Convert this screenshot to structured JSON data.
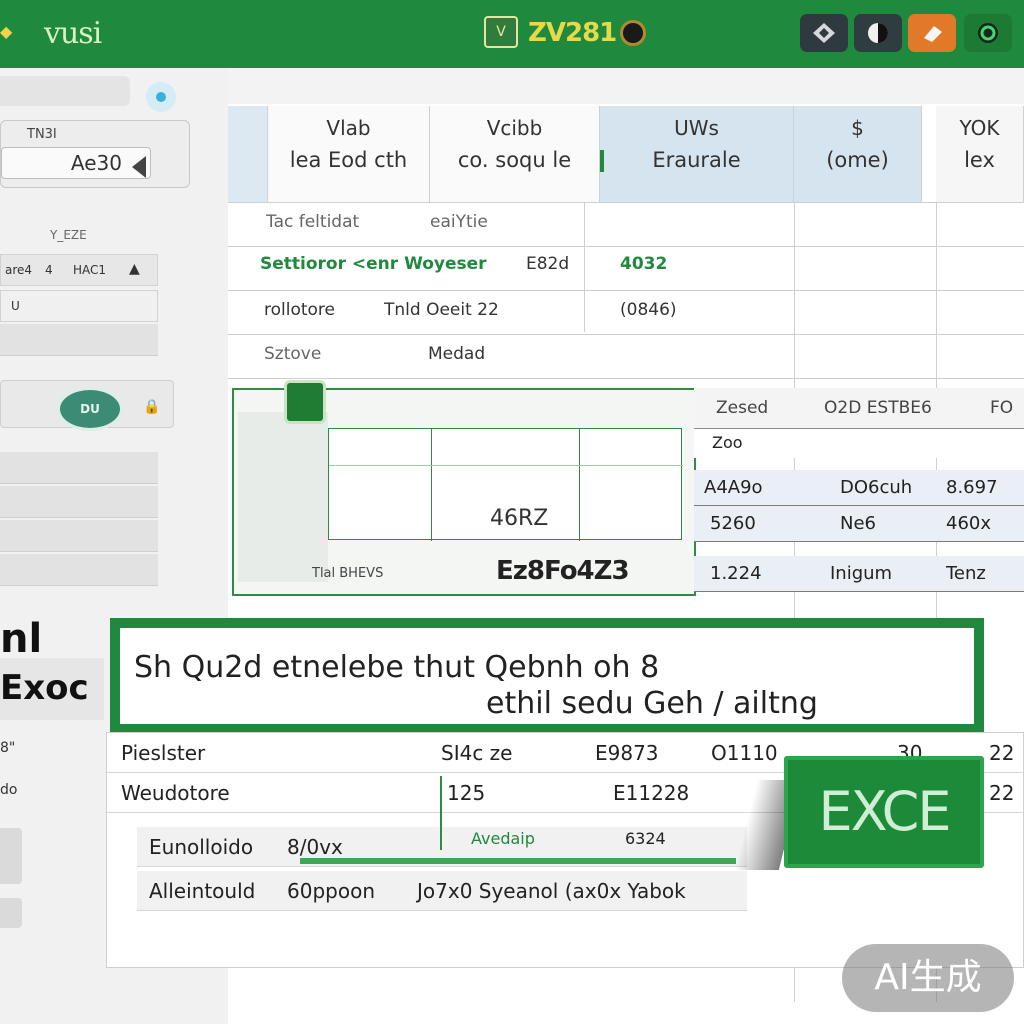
{
  "titlebar": {
    "app_title": "vusi",
    "file_badge": "V",
    "file_code": "ZV281"
  },
  "sidebar": {
    "card_label": "TN3I",
    "card_value": "Ae30",
    "section_title": "Y_EZE",
    "row1": [
      "are4",
      "4",
      "HAC1",
      "▲"
    ],
    "row2": [
      "U"
    ],
    "logo_text": "DU",
    "big_text_1": "nl",
    "big_text_2": "Exoc",
    "small_1": "8\"",
    "small_2": "do"
  },
  "headers": [
    {
      "l1": "",
      "l2": ""
    },
    {
      "l1": "Vlab",
      "l2": "lea Eod cth"
    },
    {
      "l1": "Vcibb",
      "l2": "co. soqu le"
    },
    {
      "l1": "UWs",
      "l2": "Eraurale"
    },
    {
      "l1": "$",
      "l2": "(ome)"
    },
    {
      "l1": "YOK",
      "l2": "lex"
    }
  ],
  "rows": {
    "r1": {
      "a": "Tac feltidat",
      "b": "eaiYtie"
    },
    "r2": {
      "a": "Settioror <enr Woyeser",
      "b": "E82d",
      "c": "4032"
    },
    "r3": {
      "a": "rollotore",
      "b": "Tnld Oeeit 22",
      "c": "(0846)"
    },
    "r4": {
      "a": "Sztove",
      "b": "Medad"
    }
  },
  "panel": {
    "value": "46RZ",
    "foot_left": "Tlal BHEVS",
    "foot_right": "Ez8Fo4Z3"
  },
  "right_table": {
    "head_a": "Zesed",
    "head_b": "O2D ESTBE6",
    "head_c": "FO",
    "sub_a": "Zoo",
    "rows": [
      [
        "A4A9o",
        "DO6cuh",
        "8.697"
      ],
      [
        "5260",
        "Ne6",
        "460x"
      ],
      [
        "1.224",
        "Inigum",
        "Tenz"
      ]
    ]
  },
  "formula_bar": {
    "line1": "Sh Qu2d etnelebe thut Qebnh oh 8",
    "line2": "ethil sedu Geh / ailtng"
  },
  "lower_table": {
    "rows": [
      [
        "Pieslster",
        "SI4c ze",
        "E9873",
        "O1110",
        "30",
        "22"
      ],
      [
        "Weudotore",
        "125",
        "E11228",
        "",
        "",
        "22"
      ],
      [
        "Eunolloido",
        "8/0vx",
        "",
        "6324",
        "",
        ""
      ],
      [
        "Alleintould",
        "60ppoon",
        "Jo7x0 Syeanol (ax0x Yabok",
        "",
        "",
        ""
      ]
    ],
    "mid_label": "Avedaip"
  },
  "excel_tile": "EXCE",
  "watermark": "AI生成"
}
